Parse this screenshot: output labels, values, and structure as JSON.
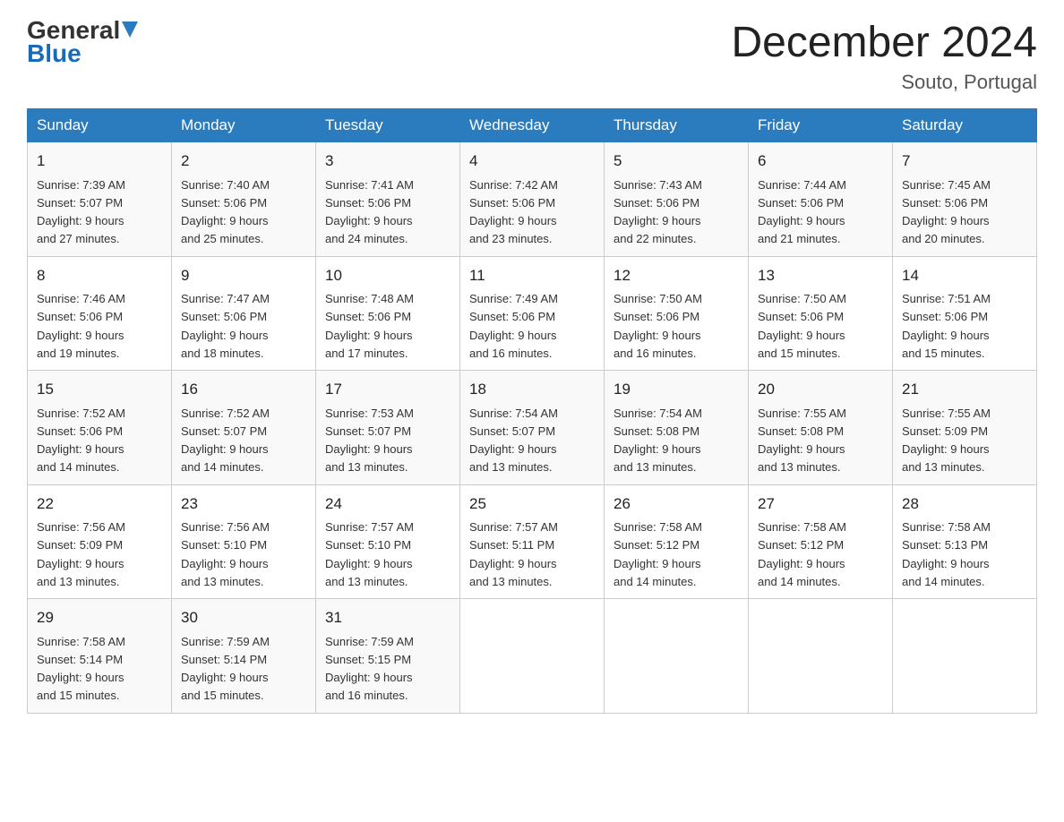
{
  "header": {
    "logo_general": "General",
    "logo_blue": "Blue",
    "month_title": "December 2024",
    "location": "Souto, Portugal"
  },
  "days_of_week": [
    "Sunday",
    "Monday",
    "Tuesday",
    "Wednesday",
    "Thursday",
    "Friday",
    "Saturday"
  ],
  "weeks": [
    [
      {
        "num": "1",
        "sunrise": "7:39 AM",
        "sunset": "5:07 PM",
        "daylight": "9 hours and 27 minutes."
      },
      {
        "num": "2",
        "sunrise": "7:40 AM",
        "sunset": "5:06 PM",
        "daylight": "9 hours and 25 minutes."
      },
      {
        "num": "3",
        "sunrise": "7:41 AM",
        "sunset": "5:06 PM",
        "daylight": "9 hours and 24 minutes."
      },
      {
        "num": "4",
        "sunrise": "7:42 AM",
        "sunset": "5:06 PM",
        "daylight": "9 hours and 23 minutes."
      },
      {
        "num": "5",
        "sunrise": "7:43 AM",
        "sunset": "5:06 PM",
        "daylight": "9 hours and 22 minutes."
      },
      {
        "num": "6",
        "sunrise": "7:44 AM",
        "sunset": "5:06 PM",
        "daylight": "9 hours and 21 minutes."
      },
      {
        "num": "7",
        "sunrise": "7:45 AM",
        "sunset": "5:06 PM",
        "daylight": "9 hours and 20 minutes."
      }
    ],
    [
      {
        "num": "8",
        "sunrise": "7:46 AM",
        "sunset": "5:06 PM",
        "daylight": "9 hours and 19 minutes."
      },
      {
        "num": "9",
        "sunrise": "7:47 AM",
        "sunset": "5:06 PM",
        "daylight": "9 hours and 18 minutes."
      },
      {
        "num": "10",
        "sunrise": "7:48 AM",
        "sunset": "5:06 PM",
        "daylight": "9 hours and 17 minutes."
      },
      {
        "num": "11",
        "sunrise": "7:49 AM",
        "sunset": "5:06 PM",
        "daylight": "9 hours and 16 minutes."
      },
      {
        "num": "12",
        "sunrise": "7:50 AM",
        "sunset": "5:06 PM",
        "daylight": "9 hours and 16 minutes."
      },
      {
        "num": "13",
        "sunrise": "7:50 AM",
        "sunset": "5:06 PM",
        "daylight": "9 hours and 15 minutes."
      },
      {
        "num": "14",
        "sunrise": "7:51 AM",
        "sunset": "5:06 PM",
        "daylight": "9 hours and 15 minutes."
      }
    ],
    [
      {
        "num": "15",
        "sunrise": "7:52 AM",
        "sunset": "5:06 PM",
        "daylight": "9 hours and 14 minutes."
      },
      {
        "num": "16",
        "sunrise": "7:52 AM",
        "sunset": "5:07 PM",
        "daylight": "9 hours and 14 minutes."
      },
      {
        "num": "17",
        "sunrise": "7:53 AM",
        "sunset": "5:07 PM",
        "daylight": "9 hours and 13 minutes."
      },
      {
        "num": "18",
        "sunrise": "7:54 AM",
        "sunset": "5:07 PM",
        "daylight": "9 hours and 13 minutes."
      },
      {
        "num": "19",
        "sunrise": "7:54 AM",
        "sunset": "5:08 PM",
        "daylight": "9 hours and 13 minutes."
      },
      {
        "num": "20",
        "sunrise": "7:55 AM",
        "sunset": "5:08 PM",
        "daylight": "9 hours and 13 minutes."
      },
      {
        "num": "21",
        "sunrise": "7:55 AM",
        "sunset": "5:09 PM",
        "daylight": "9 hours and 13 minutes."
      }
    ],
    [
      {
        "num": "22",
        "sunrise": "7:56 AM",
        "sunset": "5:09 PM",
        "daylight": "9 hours and 13 minutes."
      },
      {
        "num": "23",
        "sunrise": "7:56 AM",
        "sunset": "5:10 PM",
        "daylight": "9 hours and 13 minutes."
      },
      {
        "num": "24",
        "sunrise": "7:57 AM",
        "sunset": "5:10 PM",
        "daylight": "9 hours and 13 minutes."
      },
      {
        "num": "25",
        "sunrise": "7:57 AM",
        "sunset": "5:11 PM",
        "daylight": "9 hours and 13 minutes."
      },
      {
        "num": "26",
        "sunrise": "7:58 AM",
        "sunset": "5:12 PM",
        "daylight": "9 hours and 14 minutes."
      },
      {
        "num": "27",
        "sunrise": "7:58 AM",
        "sunset": "5:12 PM",
        "daylight": "9 hours and 14 minutes."
      },
      {
        "num": "28",
        "sunrise": "7:58 AM",
        "sunset": "5:13 PM",
        "daylight": "9 hours and 14 minutes."
      }
    ],
    [
      {
        "num": "29",
        "sunrise": "7:58 AM",
        "sunset": "5:14 PM",
        "daylight": "9 hours and 15 minutes."
      },
      {
        "num": "30",
        "sunrise": "7:59 AM",
        "sunset": "5:14 PM",
        "daylight": "9 hours and 15 minutes."
      },
      {
        "num": "31",
        "sunrise": "7:59 AM",
        "sunset": "5:15 PM",
        "daylight": "9 hours and 16 minutes."
      },
      null,
      null,
      null,
      null
    ]
  ],
  "labels": {
    "sunrise": "Sunrise:",
    "sunset": "Sunset:",
    "daylight": "Daylight:"
  }
}
